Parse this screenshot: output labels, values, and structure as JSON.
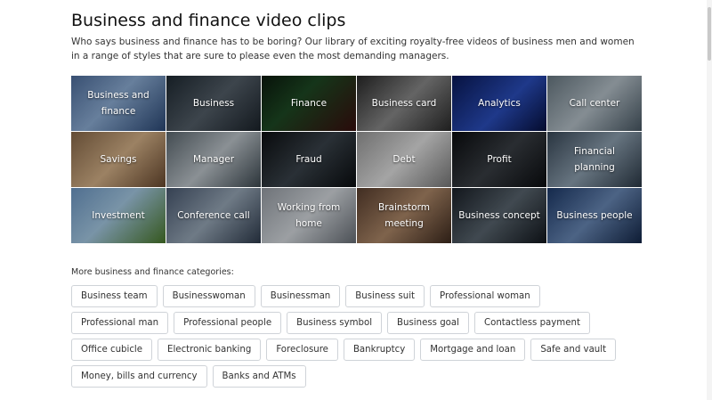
{
  "header": {
    "title": "Business and finance video clips",
    "intro": "Who says business and finance has to be boring? Our library of exciting royalty-free videos of business men and women in a range of styles that are sure to please even the most demanding managers."
  },
  "tiles": [
    {
      "label": "Business and finance",
      "bg": "linear-gradient(135deg,#4f6f9f 0%,#8fb0d8 45%,#2c4a78 100%)"
    },
    {
      "label": "Business",
      "bg": "linear-gradient(135deg,#1f2a33 0%,#55606a 50%,#1b232b 100%)"
    },
    {
      "label": "Finance",
      "bg": "linear-gradient(135deg,#0b1a0e 0%,#1e4a24 40%,#3a0f0f 100%)"
    },
    {
      "label": "Business card",
      "bg": "linear-gradient(135deg,#2a2a2a 0%,#8b8b8b 50%,#2a2a2a 100%)"
    },
    {
      "label": "Analytics",
      "bg": "linear-gradient(135deg,#0a1a5a 0%,#2b4fbf 55%,#061040 100%)"
    },
    {
      "label": "Call center",
      "bg": "linear-gradient(135deg,#6a7a84 0%,#b8c4cc 50%,#4a5a66 100%)"
    },
    {
      "label": "Savings",
      "bg": "linear-gradient(135deg,#8a6a4a 0%,#d8b48a 50%,#6a4a30 100%)"
    },
    {
      "label": "Manager",
      "bg": "linear-gradient(135deg,#5e6a72 0%,#c0c8ce 50%,#3e4a52 100%)"
    },
    {
      "label": "Fraud",
      "bg": "linear-gradient(135deg,#0d1013 0%,#3a434b 50%,#0a0d10 100%)"
    },
    {
      "label": "Debt",
      "bg": "linear-gradient(135deg,#9a9a9a 0%,#e4e4e4 50%,#7a7a7a 100%)"
    },
    {
      "label": "Profit",
      "bg": "linear-gradient(135deg,#0b0d10 0%,#3a3f45 50%,#0b0d10 100%)"
    },
    {
      "label": "Financial planning",
      "bg": "linear-gradient(135deg,#3a4a5a 0%,#8fa2b2 50%,#2c3a48 100%)"
    },
    {
      "label": "Investment",
      "bg": "linear-gradient(135deg,#6f9ac8 0%,#a8cde8 45%,#4a7a2a 100%)"
    },
    {
      "label": "Conference call",
      "bg": "linear-gradient(135deg,#4a5a72 0%,#9aaaba 50%,#2f3c4e 100%)"
    },
    {
      "label": "Working from home",
      "bg": "linear-gradient(135deg,#9aa0a8 0%,#d8dde2 50%,#6a7078 100%)"
    },
    {
      "label": "Brainstorm meeting",
      "bg": "linear-gradient(135deg,#5a3f2f 0%,#b08a6a 50%,#3e2a1e 100%)"
    },
    {
      "label": "Business concept",
      "bg": "linear-gradient(135deg,#1a2028 0%,#5a6670 50%,#12171d 100%)"
    },
    {
      "label": "Business people",
      "bg": "linear-gradient(135deg,#1d3a6a 0%,#6a8ab8 50%,#14284a 100%)"
    }
  ],
  "more": {
    "label": "More business and finance categories:",
    "chips": [
      "Business team",
      "Businesswoman",
      "Businessman",
      "Business suit",
      "Professional woman",
      "Professional man",
      "Professional people",
      "Business symbol",
      "Business goal",
      "Contactless payment",
      "Office cubicle",
      "Electronic banking",
      "Foreclosure",
      "Bankruptcy",
      "Mortgage and loan",
      "Safe and vault",
      "Money, bills and currency",
      "Banks and ATMs"
    ]
  }
}
